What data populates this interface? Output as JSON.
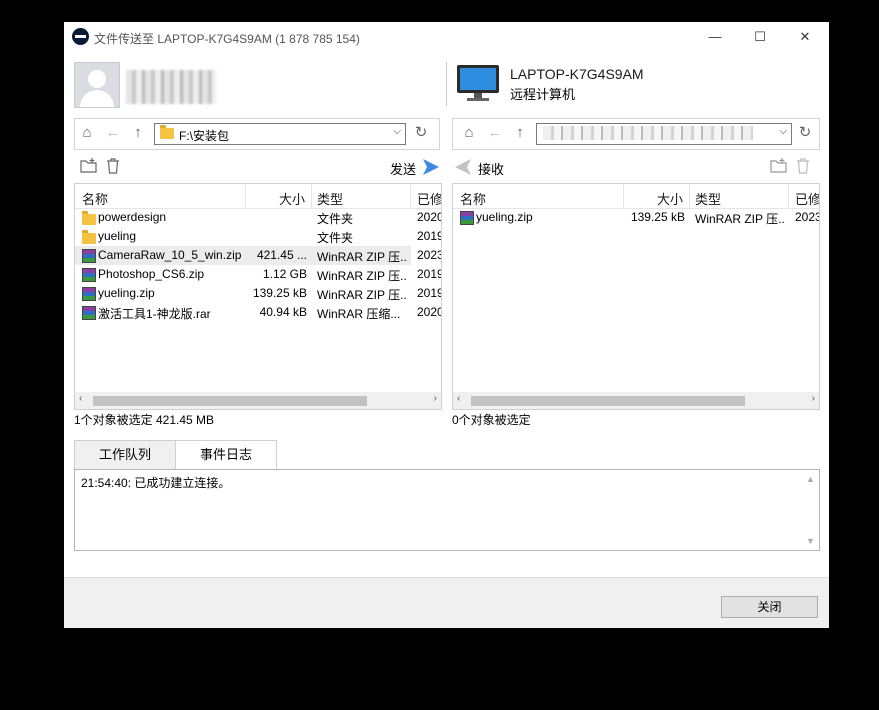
{
  "titlebar": {
    "title": "文件传送至 LAPTOP-K7G4S9AM (1 878 785 154)",
    "minimize": "—",
    "maximize": "☐",
    "close": "✕"
  },
  "header": {
    "remote_name": "LAPTOP-K7G4S9AM",
    "remote_label": "远程计算机"
  },
  "local": {
    "path": "F:\\安装包",
    "send_label": "发送",
    "columns": [
      "名称",
      "大小",
      "类型",
      "已修"
    ],
    "files": [
      {
        "icon": "folder",
        "name": "powerdesign",
        "size": "",
        "type": "文件夹",
        "date": "2020"
      },
      {
        "icon": "folder",
        "name": "yueling",
        "size": "",
        "type": "文件夹",
        "date": "2019"
      },
      {
        "icon": "zip",
        "name": "CameraRaw_10_5_win.zip",
        "size": "421.45 ...",
        "type": "WinRAR ZIP 压...",
        "date": "2023"
      },
      {
        "icon": "zip",
        "name": "Photoshop_CS6.zip",
        "size": "1.12 GB",
        "type": "WinRAR ZIP 压...",
        "date": "2019"
      },
      {
        "icon": "zip",
        "name": "yueling.zip",
        "size": "139.25 kB",
        "type": "WinRAR ZIP 压...",
        "date": "2019"
      },
      {
        "icon": "zip",
        "name": "激活工具1-神龙版.rar",
        "size": "40.94 kB",
        "type": "WinRAR 压缩...",
        "date": "2020"
      }
    ],
    "selected_index": 2,
    "status": "1个对象被选定  421.45 MB"
  },
  "remote": {
    "receive_label": "接收",
    "columns": [
      "名称",
      "大小",
      "类型",
      "已修"
    ],
    "files": [
      {
        "icon": "zip",
        "name": "yueling.zip",
        "size": "139.25 kB",
        "type": "WinRAR ZIP 压...",
        "date": "2023"
      }
    ],
    "status": "0个对象被选定"
  },
  "tabs": [
    "工作队列",
    "事件日志"
  ],
  "active_tab": 1,
  "log": [
    "21:54:40: 已成功建立连接。"
  ],
  "footer": {
    "close_label": "关闭"
  },
  "colors": {
    "accent": "#3d8be0",
    "folder": "#f5c342"
  }
}
